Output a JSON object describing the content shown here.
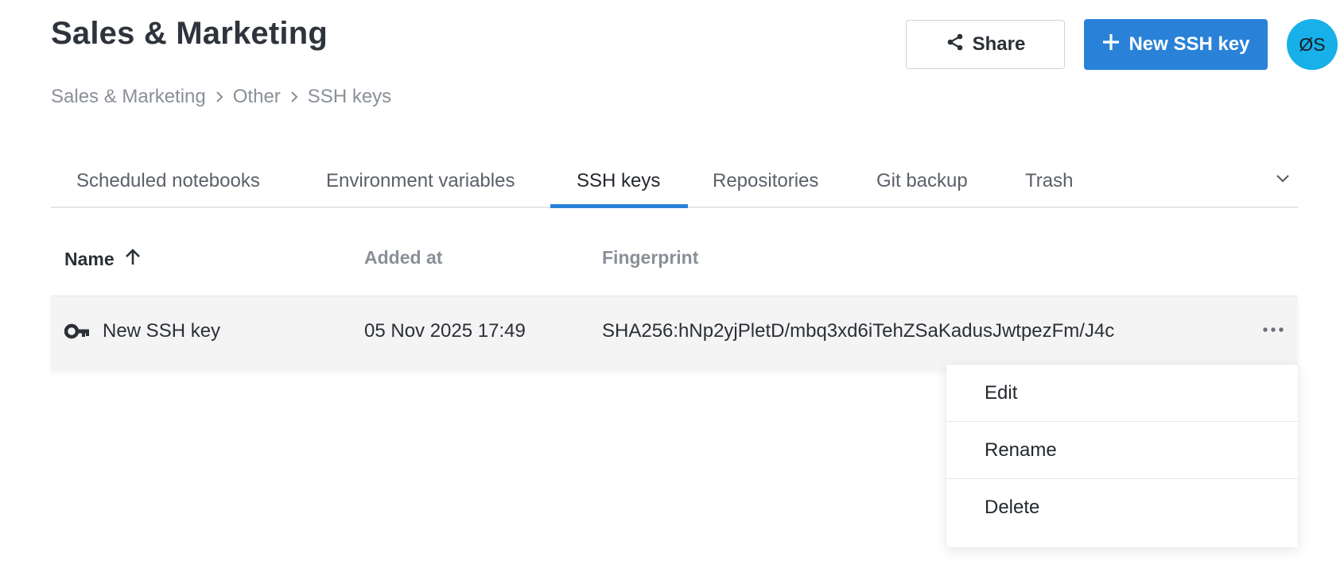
{
  "page": {
    "title": "Sales & Marketing",
    "breadcrumb": [
      "Sales & Marketing",
      "Other",
      "SSH keys"
    ]
  },
  "header": {
    "share_label": "Share",
    "new_key_label": "New SSH key",
    "avatar_initials": "ØS",
    "accent_color": "#2a82d8",
    "avatar_color": "#17b0e9"
  },
  "tabs": [
    {
      "label": "Scheduled notebooks",
      "active": false
    },
    {
      "label": "Environment variables",
      "active": false
    },
    {
      "label": "SSH keys",
      "active": true
    },
    {
      "label": "Repositories",
      "active": false
    },
    {
      "label": "Git backup",
      "active": false
    },
    {
      "label": "Trash",
      "active": false
    }
  ],
  "table": {
    "columns": [
      "Name",
      "Added at",
      "Fingerprint"
    ],
    "sort": {
      "column": "Name",
      "direction": "ascending"
    },
    "rows": [
      {
        "icon": "key-icon",
        "name": "New SSH key",
        "added_at": "05 Nov 2025 17:49",
        "fingerprint": "SHA256:hNp2yjPletD/mbq3xd6iTehZSaKadusJwtpezFm/J4c"
      }
    ]
  },
  "context_menu": {
    "items": [
      "Edit",
      "Rename",
      "Delete"
    ]
  }
}
